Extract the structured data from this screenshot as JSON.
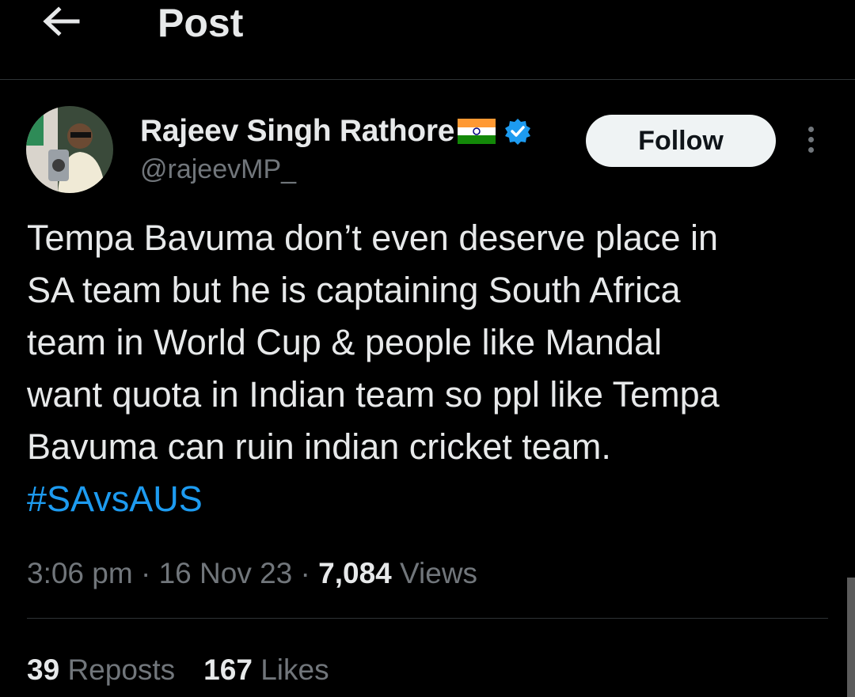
{
  "header": {
    "title": "Post",
    "back_icon": "arrow-left-icon"
  },
  "author": {
    "display_name": "Rajeev Singh Rathore",
    "handle": "@rajeevMP_",
    "flag_icon": "india-flag-icon",
    "verified_icon": "verified-badge-icon",
    "verified_color": "#1d9bf0"
  },
  "follow_button": {
    "label": "Follow"
  },
  "more_icon": "more-vertical-icon",
  "tweet": {
    "text": "Tempa Bavuma don’t even deserve place in\nSA team but he is captaining South Africa\nteam in World Cup & people like Mandal\nwant quota in Indian team so ppl like Tempa\nBavuma can ruin indian cricket team.",
    "hashtag": "#SAvsAUS"
  },
  "meta": {
    "time": "3:06 pm",
    "separator": "·",
    "date": "16 Nov 23",
    "views_count": "7,084",
    "views_label": "Views"
  },
  "stats": {
    "reposts_count": "39",
    "reposts_label": "Reposts",
    "likes_count": "167",
    "likes_label": "Likes"
  },
  "colors": {
    "background": "#000000",
    "text": "#e7e9ea",
    "muted": "#71767b",
    "link": "#1d9bf0"
  }
}
